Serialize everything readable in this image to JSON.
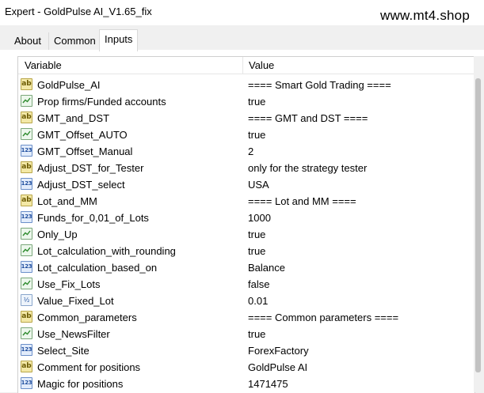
{
  "window": {
    "title": "Expert - GoldPulse AI_V1.65_fix",
    "watermark": "www.mt4.shop"
  },
  "tabs": [
    {
      "label": "About",
      "active": false
    },
    {
      "label": "Common",
      "active": false
    },
    {
      "label": "Inputs",
      "active": true
    }
  ],
  "grid": {
    "columns": {
      "variable": "Variable",
      "value": "Value"
    },
    "rows": [
      {
        "type": "string",
        "icon": "ab-icon",
        "icon_text": "ab",
        "name": "GoldPulse_AI",
        "value": "==== Smart Gold Trading ===="
      },
      {
        "type": "bool",
        "icon": "bool-icon",
        "name": "Prop firms/Funded accounts",
        "value": "true"
      },
      {
        "type": "string",
        "icon": "ab-icon",
        "icon_text": "ab",
        "name": "GMT_and_DST",
        "value": "==== GMT and DST ===="
      },
      {
        "type": "bool",
        "icon": "bool-icon",
        "name": "GMT_Offset_AUTO",
        "value": "true"
      },
      {
        "type": "int",
        "icon": "number-icon",
        "icon_text": "123",
        "name": "GMT_Offset_Manual",
        "value": "2"
      },
      {
        "type": "string",
        "icon": "ab-icon",
        "icon_text": "ab",
        "name": "Adjust_DST_for_Tester",
        "value": "only for the strategy tester"
      },
      {
        "type": "int",
        "icon": "number-icon",
        "icon_text": "123",
        "name": "Adjust_DST_select",
        "value": "USA"
      },
      {
        "type": "string",
        "icon": "ab-icon",
        "icon_text": "ab",
        "name": "Lot_and_MM",
        "value": "==== Lot and MM ===="
      },
      {
        "type": "int",
        "icon": "number-icon",
        "icon_text": "123",
        "name": "Funds_for_0,01_of_Lots",
        "value": "1000"
      },
      {
        "type": "bool",
        "icon": "bool-icon",
        "name": "Only_Up",
        "value": "true"
      },
      {
        "type": "bool",
        "icon": "bool-icon",
        "name": "Lot_calculation_with_rounding",
        "value": "true"
      },
      {
        "type": "int",
        "icon": "number-icon",
        "icon_text": "123",
        "name": "Lot_calculation_based_on",
        "value": "Balance"
      },
      {
        "type": "bool",
        "icon": "bool-icon",
        "name": "Use_Fix_Lots",
        "value": "false"
      },
      {
        "type": "double",
        "icon": "double-icon",
        "icon_text": "½",
        "name": "Value_Fixed_Lot",
        "value": "0.01"
      },
      {
        "type": "string",
        "icon": "ab-icon",
        "icon_text": "ab",
        "name": "Common_parameters",
        "value": "==== Common parameters ===="
      },
      {
        "type": "bool",
        "icon": "bool-icon",
        "name": "Use_NewsFilter",
        "value": "true"
      },
      {
        "type": "int",
        "icon": "number-icon",
        "icon_text": "123",
        "name": "Select_Site",
        "value": "ForexFactory"
      },
      {
        "type": "string",
        "icon": "ab-icon",
        "icon_text": "ab",
        "name": "Comment for positions",
        "value": "GoldPulse AI"
      },
      {
        "type": "int",
        "icon": "number-icon",
        "icon_text": "123",
        "name": "Magic for positions",
        "value": "1471475"
      }
    ]
  },
  "colors": {
    "string_icon": "#f3e8a6",
    "bool_icon_stroke": "#2e8b2e",
    "number_icon": "#1f4e9e"
  }
}
